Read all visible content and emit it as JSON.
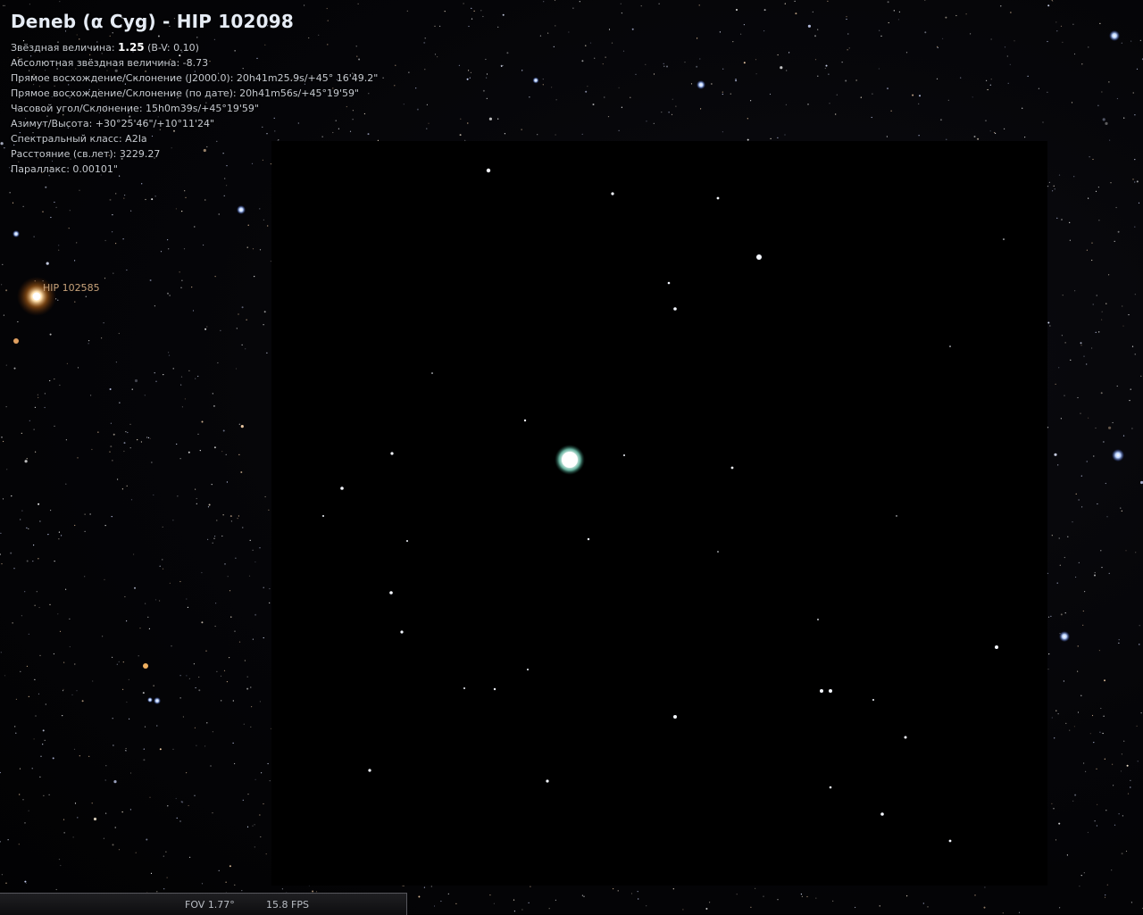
{
  "object_info": {
    "title": "Deneb (α Cyg) - HIP 102098",
    "magnitude_label": "Звёздная величина:",
    "magnitude_value": "1.25",
    "magnitude_bv": "(B-V: 0.10)",
    "abs_magnitude": "Абсолютная звёздная величина: -8.73",
    "ra_dec_j2000": "Прямое восхождение/Склонение (J2000.0): 20h41m25.9s/+45° 16'49.2\"",
    "ra_dec_date": "Прямое восхождение/Склонение (по дате): 20h41m56s/+45°19'59\"",
    "hour_angle": "Часовой угол/Склонение: 15h0m39s/+45°19'59\"",
    "az_alt": "Азимут/Высота: +30°25'46\"/+10°11'24\"",
    "spectral": "Спектральный класс: A2Ia",
    "distance": "Расстояние (св.лет): 3229.27",
    "parallax": "Параллакс: 0.00101\""
  },
  "labels": {
    "nearby_star": "HIP 102585"
  },
  "status_bar": {
    "fov": "FOV 1.77°",
    "fps": "15.8 FPS"
  },
  "colors": {
    "sky_background": "#040406",
    "patch_background": "#000000",
    "label_color": "#c7a27a"
  }
}
